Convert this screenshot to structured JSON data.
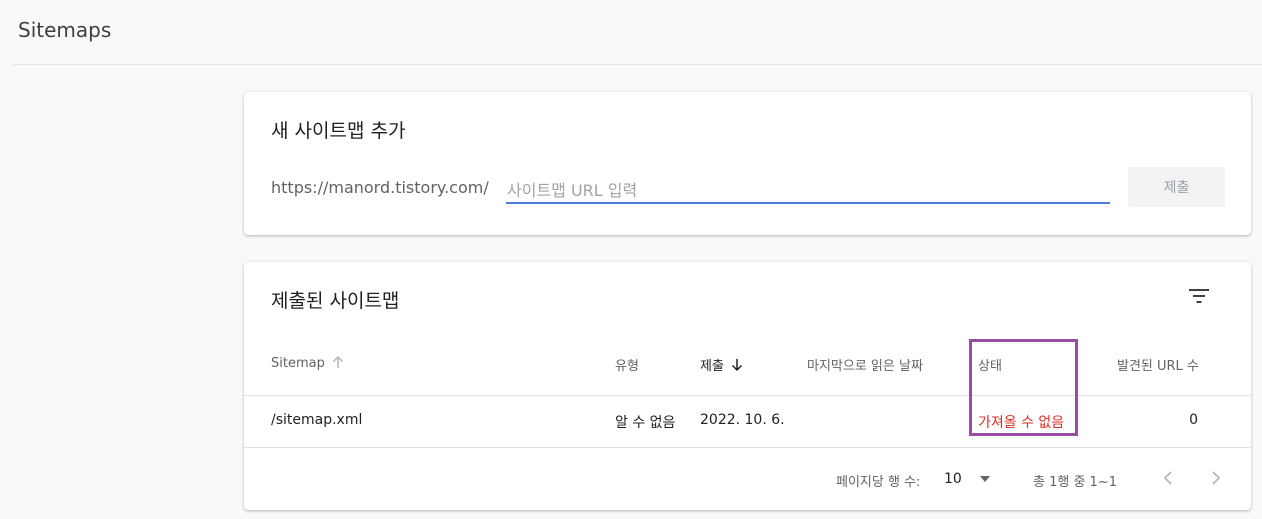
{
  "header": {
    "title": "Sitemaps"
  },
  "add_card": {
    "title": "새 사이트맵 추가",
    "url_prefix": "https://manord.tistory.com/",
    "input_value": "",
    "input_placeholder": "사이트맵 URL 입력",
    "submit_label": "제출"
  },
  "list_card": {
    "title": "제출된 사이트맵",
    "filter_icon": "filter-list-icon",
    "columns": [
      {
        "key": "sitemap",
        "label": "Sitemap",
        "sort": "asc-inactive"
      },
      {
        "key": "type",
        "label": "유형"
      },
      {
        "key": "submitted",
        "label": "제출",
        "sort": "desc-active"
      },
      {
        "key": "last_read",
        "label": "마지막으로 읽은 날짜"
      },
      {
        "key": "status",
        "label": "상태"
      },
      {
        "key": "discovered_urls",
        "label": "발견된 URL 수"
      }
    ],
    "rows": [
      {
        "sitemap": "/sitemap.xml",
        "type": "알 수 없음",
        "submitted": "2022. 10. 6.",
        "last_read": "",
        "status": "가져올 수 없음",
        "discovered_urls": "0"
      }
    ],
    "footer": {
      "rows_per_page_label": "페이지당 행 수:",
      "rows_per_page_value": "10",
      "range_label": "총 1행 중 1~1"
    }
  },
  "colors": {
    "accent": "#4a7fd6",
    "error": "#d93025",
    "highlight": "#9b4aa6"
  }
}
